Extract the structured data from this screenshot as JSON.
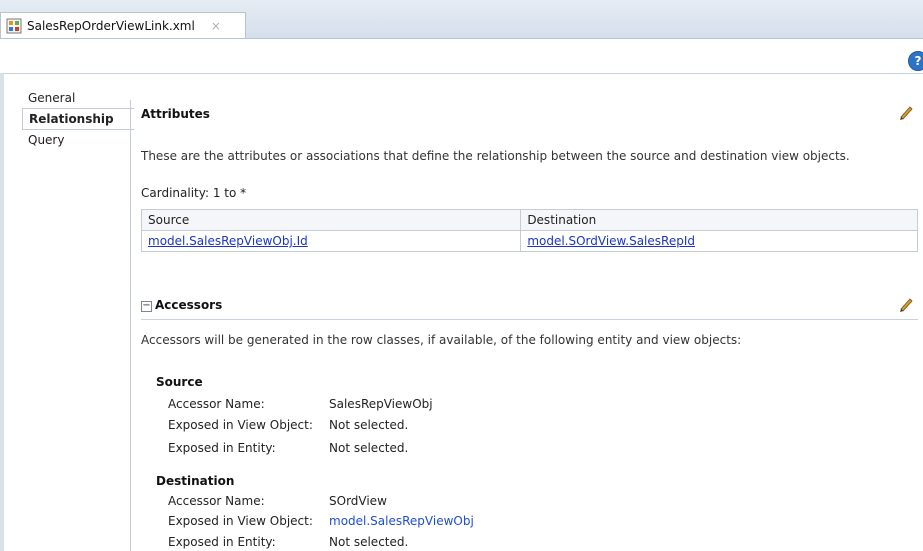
{
  "tab": {
    "title": "SalesRepOrderViewLink.xml",
    "close_glyph": "×"
  },
  "toolbar": {
    "help_glyph": "?"
  },
  "sidebar": {
    "items": [
      {
        "label": "General",
        "active": false
      },
      {
        "label": "Relationship",
        "active": true
      },
      {
        "label": "Query",
        "active": false
      }
    ]
  },
  "attributes": {
    "title": "Attributes",
    "description": "These are the attributes or associations that define the relationship between the source and destination view objects.",
    "cardinality_label": "Cardinality:",
    "cardinality_value": "1 to *",
    "table": {
      "headers": [
        "Source",
        "Destination"
      ],
      "rows": [
        [
          "model.SalesRepViewObj.Id",
          "model.SOrdView.SalesRepId"
        ]
      ]
    }
  },
  "accessors": {
    "title": "Accessors",
    "collapse_glyph": "−",
    "description": "Accessors will be generated in the row classes, if available, of the following entity and view objects:",
    "source": {
      "title": "Source",
      "rows": [
        {
          "key": "Accessor Name:",
          "value": "SalesRepViewObj"
        },
        {
          "key": "Exposed in View Object:",
          "value": "Not selected."
        },
        {
          "key": "Exposed in Entity:",
          "value": "Not selected."
        }
      ]
    },
    "destination": {
      "title": "Destination",
      "rows": [
        {
          "key": "Accessor Name:",
          "value": "SOrdView"
        },
        {
          "key": "Exposed in View Object:",
          "value": "model.SalesRepViewObj"
        },
        {
          "key": "Exposed in Entity:",
          "value": "Not selected."
        }
      ]
    }
  },
  "icons": {
    "tab": "xml-file-icon",
    "help": "help-icon",
    "edit": "pencil-icon"
  },
  "colors": {
    "link": "#1a35c7",
    "help": "#2e73c6",
    "pencil": "#c08a2b"
  }
}
